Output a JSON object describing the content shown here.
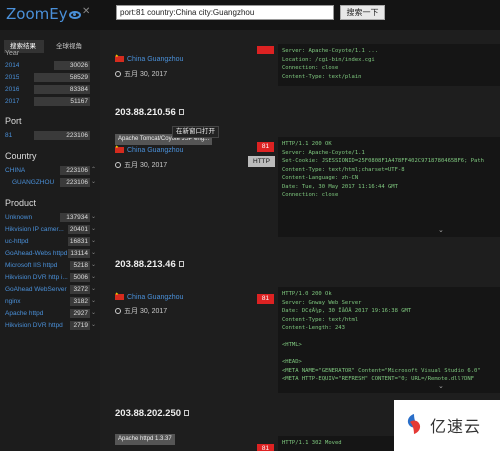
{
  "header": {
    "logo": "ZoomEy",
    "search_value": "port:81 country:China city:Guangzhou",
    "search_button": "搜索一下"
  },
  "sidebar": {
    "tabs": [
      "搜索结果",
      "全球视角"
    ],
    "year_header": "Year",
    "years": [
      {
        "label": "2014",
        "count": "30026"
      },
      {
        "label": "2015",
        "count": "58529"
      },
      {
        "label": "2016",
        "count": "83384"
      },
      {
        "label": "2017",
        "count": "51167"
      }
    ],
    "port_header": "Port",
    "ports": [
      {
        "label": "81",
        "count": "223106"
      }
    ],
    "country_header": "Country",
    "countries": [
      {
        "label": "CHINA",
        "count": "223106"
      },
      {
        "label": "GUANGZHOU",
        "count": "223106"
      }
    ],
    "product_header": "Product",
    "products": [
      {
        "label": "Unknown",
        "count": "137934"
      },
      {
        "label": "Hikvision IP camer...",
        "count": "20401"
      },
      {
        "label": "uc-httpd",
        "count": "16831"
      },
      {
        "label": "GoAhead-Webs httpd",
        "count": "13114"
      },
      {
        "label": "Microsoft IIS httpd",
        "count": "5218"
      },
      {
        "label": "Hikvision DVR http i...",
        "count": "5006"
      },
      {
        "label": "GoAhead WebServer",
        "count": "3272"
      },
      {
        "label": "nginx",
        "count": "3182"
      },
      {
        "label": "Apache httpd",
        "count": "2927"
      },
      {
        "label": "Hikvision DVR httpd",
        "count": "2719"
      }
    ]
  },
  "results": [
    {
      "ip": "",
      "location": "China Guangzhou",
      "date": "五月 30, 2017",
      "port": "",
      "protocol": "",
      "response": "Server: Apache-Coyote/1.1 ...\nLocation: /cgi-bin/index.cgi\nConnection: close\nContent-Type: text/plain"
    },
    {
      "ip": "203.88.210.56",
      "tag": "Apache Tomcat/Coyote JSP eng...",
      "location": "China Guangzhou",
      "date": "五月 30, 2017",
      "port": "81",
      "protocol": "HTTP",
      "response": "HTTP/1.1 200 OK\nServer: Apache-Coyote/1.1\nSet-Cookie: JSESSIONID=25F0808F1A478FF402C9718780465BF6; Path\nContent-Type: text/html;charset=UTF-8\nContent-Language: zh-CN\nDate: Tue, 30 May 2017 11:16:44 GMT\nConnection: close"
    },
    {
      "ip": "203.88.213.46",
      "location": "China Guangzhou",
      "date": "五月 30, 2017",
      "port": "81",
      "response": "HTTP/1.0 200 Ok\nServer: Gnway Web Server\nDate: DC¢Ã¼p, 30 ÎåÔÂ 2017 19:16:38 GMT\nContent-Type: text/html\nContent-Length: 243\n\n<HTML>\n\n<HEAD>\n<META NAME=\"GENERATOR\" Content=\"Microsoft Visual Studio 6.0\"\n<META HTTP-EQUIV=\"REFRESH\" CONTENT=\"0; URL=/Remote.dll?DNF"
    },
    {
      "ip": "203.88.202.250",
      "tag": "Apache httpd 1.3.37",
      "port": "81",
      "response": "HTTP/1.1 302 Moved"
    }
  ],
  "tooltip": "在新窗口打开",
  "watermark": "亿速云",
  "colors": {
    "accent": "#4a90d9",
    "port_badge": "#dd2222",
    "response_text": "#7fc97f"
  }
}
